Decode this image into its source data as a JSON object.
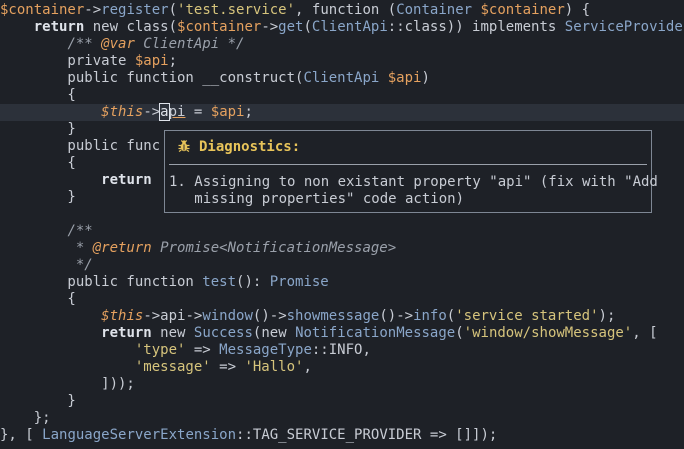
{
  "code_lines": [
    [
      [
        "var",
        "$container"
      ],
      [
        "plain",
        "->"
      ],
      [
        "fn",
        "register"
      ],
      [
        "plain",
        "("
      ],
      [
        "str",
        "'test.service'"
      ],
      [
        "plain",
        ", function ("
      ],
      [
        "type",
        "Container"
      ],
      [
        "plain",
        " "
      ],
      [
        "var",
        "$container"
      ],
      [
        "plain",
        ") {"
      ]
    ],
    [
      [
        "plain",
        "    "
      ],
      [
        "kwb",
        "return"
      ],
      [
        "plain",
        " new class("
      ],
      [
        "var",
        "$container"
      ],
      [
        "plain",
        "->"
      ],
      [
        "fn",
        "get"
      ],
      [
        "plain",
        "("
      ],
      [
        "type",
        "ClientApi"
      ],
      [
        "plain",
        "::class)) implements "
      ],
      [
        "type",
        "ServiceProvider"
      ],
      [
        "plain",
        " {"
      ]
    ],
    [
      [
        "plain",
        "        "
      ],
      [
        "comment",
        "/** "
      ],
      [
        "tag",
        "@var"
      ],
      [
        "comment",
        " ClientApi */"
      ]
    ],
    [
      [
        "plain",
        "        private "
      ],
      [
        "var",
        "$api"
      ],
      [
        "plain",
        ";"
      ]
    ],
    [
      [
        "plain",
        "        public function __construct("
      ],
      [
        "type",
        "ClientApi"
      ],
      [
        "plain",
        " "
      ],
      [
        "var",
        "$api"
      ],
      [
        "plain",
        ")"
      ]
    ],
    [
      [
        "plain",
        "        {"
      ]
    ],
    [
      [
        "plain",
        "            "
      ],
      [
        "this",
        "$this"
      ],
      [
        "plain",
        "->"
      ],
      [
        "cursor",
        "a"
      ],
      [
        "underline",
        "pi"
      ],
      [
        "plain",
        " = "
      ],
      [
        "var",
        "$api"
      ],
      [
        "plain",
        ";"
      ]
    ],
    [
      [
        "plain",
        "        }"
      ]
    ],
    [
      [
        "plain",
        "        public func"
      ]
    ],
    [
      [
        "plain",
        "        {"
      ]
    ],
    [
      [
        "plain",
        "            "
      ],
      [
        "kwb",
        "return"
      ]
    ],
    [
      [
        "plain",
        "        }"
      ]
    ],
    [
      [
        "plain",
        ""
      ]
    ],
    [
      [
        "plain",
        "        "
      ],
      [
        "comment",
        "/**"
      ]
    ],
    [
      [
        "plain",
        "         "
      ],
      [
        "comment",
        "* "
      ],
      [
        "tag",
        "@return"
      ],
      [
        "comment",
        " Promise<NotificationMessage>"
      ]
    ],
    [
      [
        "plain",
        "         "
      ],
      [
        "comment",
        "*/"
      ]
    ],
    [
      [
        "plain",
        "        public function "
      ],
      [
        "fn",
        "test"
      ],
      [
        "plain",
        "(): "
      ],
      [
        "type",
        "Promise"
      ]
    ],
    [
      [
        "plain",
        "        {"
      ]
    ],
    [
      [
        "plain",
        "            "
      ],
      [
        "this",
        "$this"
      ],
      [
        "plain",
        "->api->"
      ],
      [
        "fn",
        "window"
      ],
      [
        "plain",
        "()->"
      ],
      [
        "fn",
        "showmessage"
      ],
      [
        "plain",
        "()->"
      ],
      [
        "fn",
        "info"
      ],
      [
        "plain",
        "("
      ],
      [
        "str",
        "'service started'"
      ],
      [
        "plain",
        ");"
      ]
    ],
    [
      [
        "plain",
        "            "
      ],
      [
        "kwb",
        "return"
      ],
      [
        "plain",
        " new "
      ],
      [
        "type",
        "Success"
      ],
      [
        "plain",
        "(new "
      ],
      [
        "type",
        "NotificationMessage"
      ],
      [
        "plain",
        "("
      ],
      [
        "str",
        "'window/showMessage'"
      ],
      [
        "plain",
        ", ["
      ]
    ],
    [
      [
        "plain",
        "                "
      ],
      [
        "str",
        "'type'"
      ],
      [
        "plain",
        " => "
      ],
      [
        "type",
        "MessageType"
      ],
      [
        "plain",
        "::INFO,"
      ]
    ],
    [
      [
        "plain",
        "                "
      ],
      [
        "str",
        "'message'"
      ],
      [
        "plain",
        " => "
      ],
      [
        "str",
        "'Hallo'"
      ],
      [
        "plain",
        ","
      ]
    ],
    [
      [
        "plain",
        "            ]));"
      ]
    ],
    [
      [
        "plain",
        "        }"
      ]
    ],
    [
      [
        "plain",
        "    };"
      ]
    ],
    [
      [
        "plain",
        "}, [ "
      ],
      [
        "type",
        "LanguageServerExtension"
      ],
      [
        "plain",
        "::TAG_SERVICE_PROVIDER => []]);"
      ]
    ]
  ],
  "cursor_line_index": 6,
  "diagnostics": {
    "title": "Diagnostics:",
    "icon": "bug-icon",
    "message_lines": [
      "1. Assigning to non existant property \"api\" (fix with \"Add",
      "   missing properties\" code action)"
    ],
    "colors": {
      "title": "#e8c45a",
      "border": "#7e8794"
    }
  }
}
